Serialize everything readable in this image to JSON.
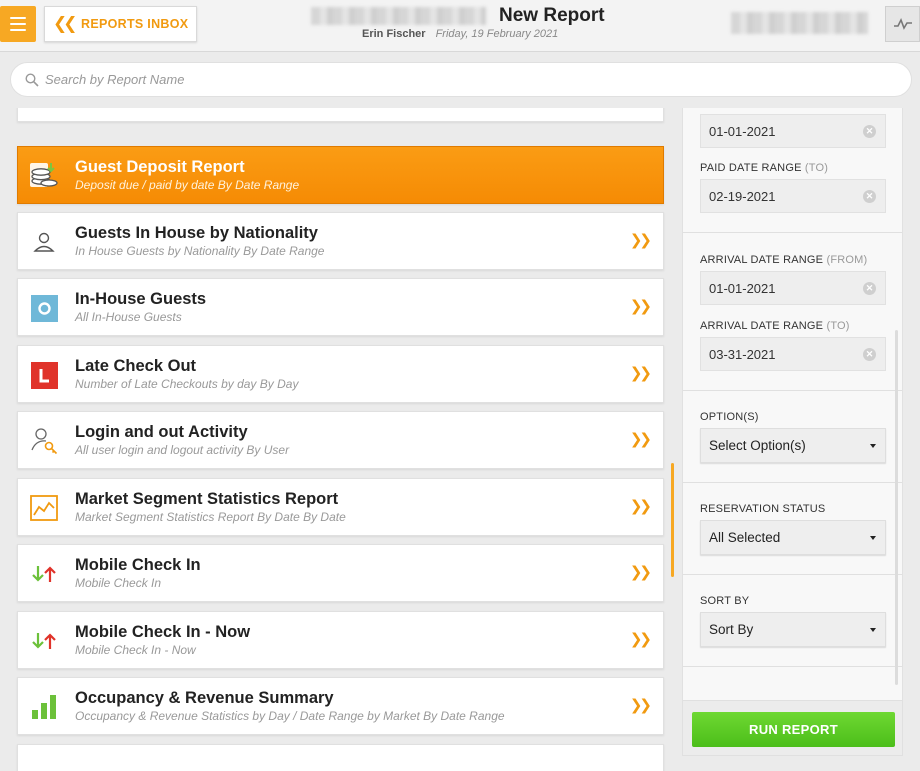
{
  "header": {
    "inbox_label": "REPORTS INBOX",
    "title": "New Report",
    "user": "Erin Fischer",
    "date": "Friday, 19 February 2021"
  },
  "search": {
    "placeholder": "Search by Report Name"
  },
  "reports": [
    {
      "title": "Guest Deposit Report",
      "subtitle": "Deposit due / paid by date By Date Range",
      "icon": "coins-icon",
      "active": true
    },
    {
      "title": "Guests In House by Nationality",
      "subtitle": "In House Guests by Nationality By Date Range",
      "icon": "person-outline-icon"
    },
    {
      "title": "In-House Guests",
      "subtitle": "All In-House Guests",
      "icon": "blue-square-circle-icon"
    },
    {
      "title": "Late Check Out",
      "subtitle": "Number of Late Checkouts by day By Day",
      "icon": "red-l-icon"
    },
    {
      "title": "Login and out Activity",
      "subtitle": "All user login and logout activity By User",
      "icon": "user-key-icon"
    },
    {
      "title": "Market Segment Statistics Report",
      "subtitle": "Market Segment Statistics Report By Date By Date",
      "icon": "line-chart-icon"
    },
    {
      "title": "Mobile Check In",
      "subtitle": "Mobile Check In",
      "icon": "down-up-arrows-icon"
    },
    {
      "title": "Mobile Check In - Now",
      "subtitle": "Mobile Check In - Now",
      "icon": "down-up-arrows-icon"
    },
    {
      "title": "Occupancy & Revenue Summary",
      "subtitle": "Occupancy & Revenue Statistics by Day / Date Range by Market By Date Range",
      "icon": "bar-chart-icon"
    }
  ],
  "filters": {
    "paid_from_value": "01-01-2021",
    "paid_to_label": "PAID DATE RANGE",
    "paid_to_suffix": "(TO)",
    "paid_to_value": "02-19-2021",
    "arrival_from_label": "ARRIVAL DATE RANGE",
    "arrival_from_suffix": "(FROM)",
    "arrival_from_value": "01-01-2021",
    "arrival_to_label": "ARRIVAL DATE RANGE",
    "arrival_to_suffix": "(TO)",
    "arrival_to_value": "03-31-2021",
    "options_label": "OPTION(S)",
    "options_value": "Select Option(s)",
    "status_label": "RESERVATION STATUS",
    "status_value": "All Selected",
    "sort_label": "SORT BY",
    "sort_value": "Sort By"
  },
  "run_label": "RUN REPORT",
  "colors": {
    "accent": "#f7a823",
    "active_row": "#f58b04",
    "run": "#5bc826"
  }
}
